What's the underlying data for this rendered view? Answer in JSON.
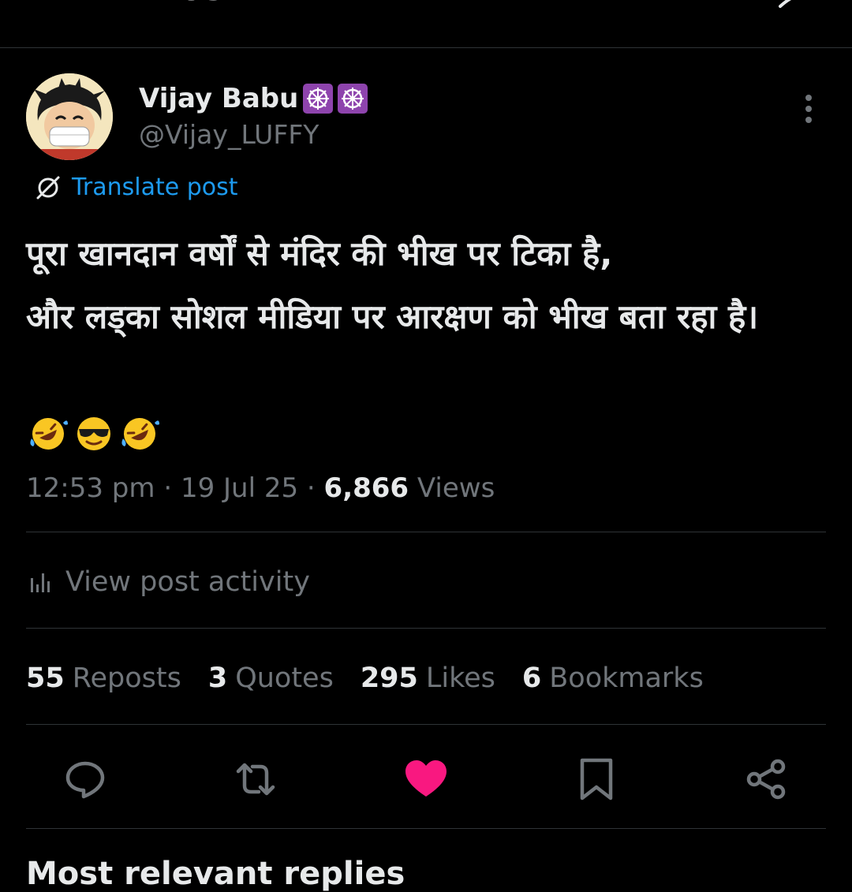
{
  "header": {
    "title": "Post"
  },
  "author": {
    "display_name": "Vijay Babu",
    "handle": "@Vijay_LUFFY",
    "badges": [
      "wheel-of-dharma-icon",
      "wheel-of-dharma-icon"
    ]
  },
  "translate": {
    "label": "Translate post"
  },
  "post": {
    "text": "पूरा खानदान वर्षों से मंदिर की भीख पर टिका है,\nऔर लड्का सोशल मीडिया पर आरक्षण को भीख बता रहा है।",
    "emojis": [
      "rofl-emoji-icon",
      "sunglasses-emoji-icon",
      "rofl-emoji-icon"
    ]
  },
  "meta": {
    "time": "12:53 pm",
    "separator": "·",
    "date": "19 Jul 25",
    "views_count": "6,866",
    "views_label": "Views"
  },
  "activity": {
    "label": "View post activity"
  },
  "stats": {
    "reposts": {
      "count": "55",
      "label": "Reposts"
    },
    "quotes": {
      "count": "3",
      "label": "Quotes"
    },
    "likes": {
      "count": "295",
      "label": "Likes"
    },
    "bookmarks": {
      "count": "6",
      "label": "Bookmarks"
    }
  },
  "actions": [
    "reply-icon",
    "repost-icon",
    "like-icon",
    "bookmark-icon",
    "share-icon"
  ],
  "colors": {
    "accent": "#1d9bf0",
    "like": "#f91880",
    "muted": "#71767b",
    "divider": "#2f3336"
  },
  "bottom": {
    "peek_text": "Most relevant replies"
  }
}
